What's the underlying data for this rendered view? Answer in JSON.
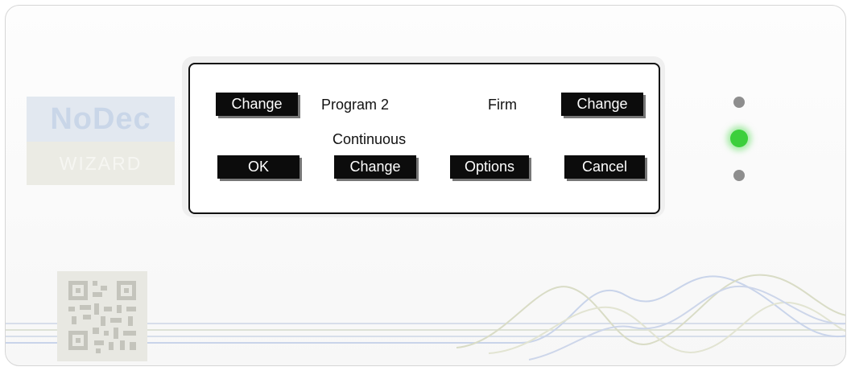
{
  "logo": {
    "brand": "NoDec",
    "subtitle": "WIZARD"
  },
  "display": {
    "program": "Program 2",
    "mode": "Firm",
    "run_mode": "Continuous"
  },
  "softkeys": {
    "change_program": "Change",
    "change_mode": "Change",
    "ok": "OK",
    "change_run_mode": "Change",
    "options": "Options",
    "cancel": "Cancel"
  },
  "leds": [
    {
      "name": "top",
      "state": "off",
      "color": "#8e8e8e"
    },
    {
      "name": "middle",
      "state": "on",
      "color": "#3ccf3c"
    },
    {
      "name": "bottom",
      "state": "off",
      "color": "#8e8e8e"
    }
  ],
  "decoration": {
    "qr_code": "qr-code-icon",
    "waves": "wave-lines"
  }
}
